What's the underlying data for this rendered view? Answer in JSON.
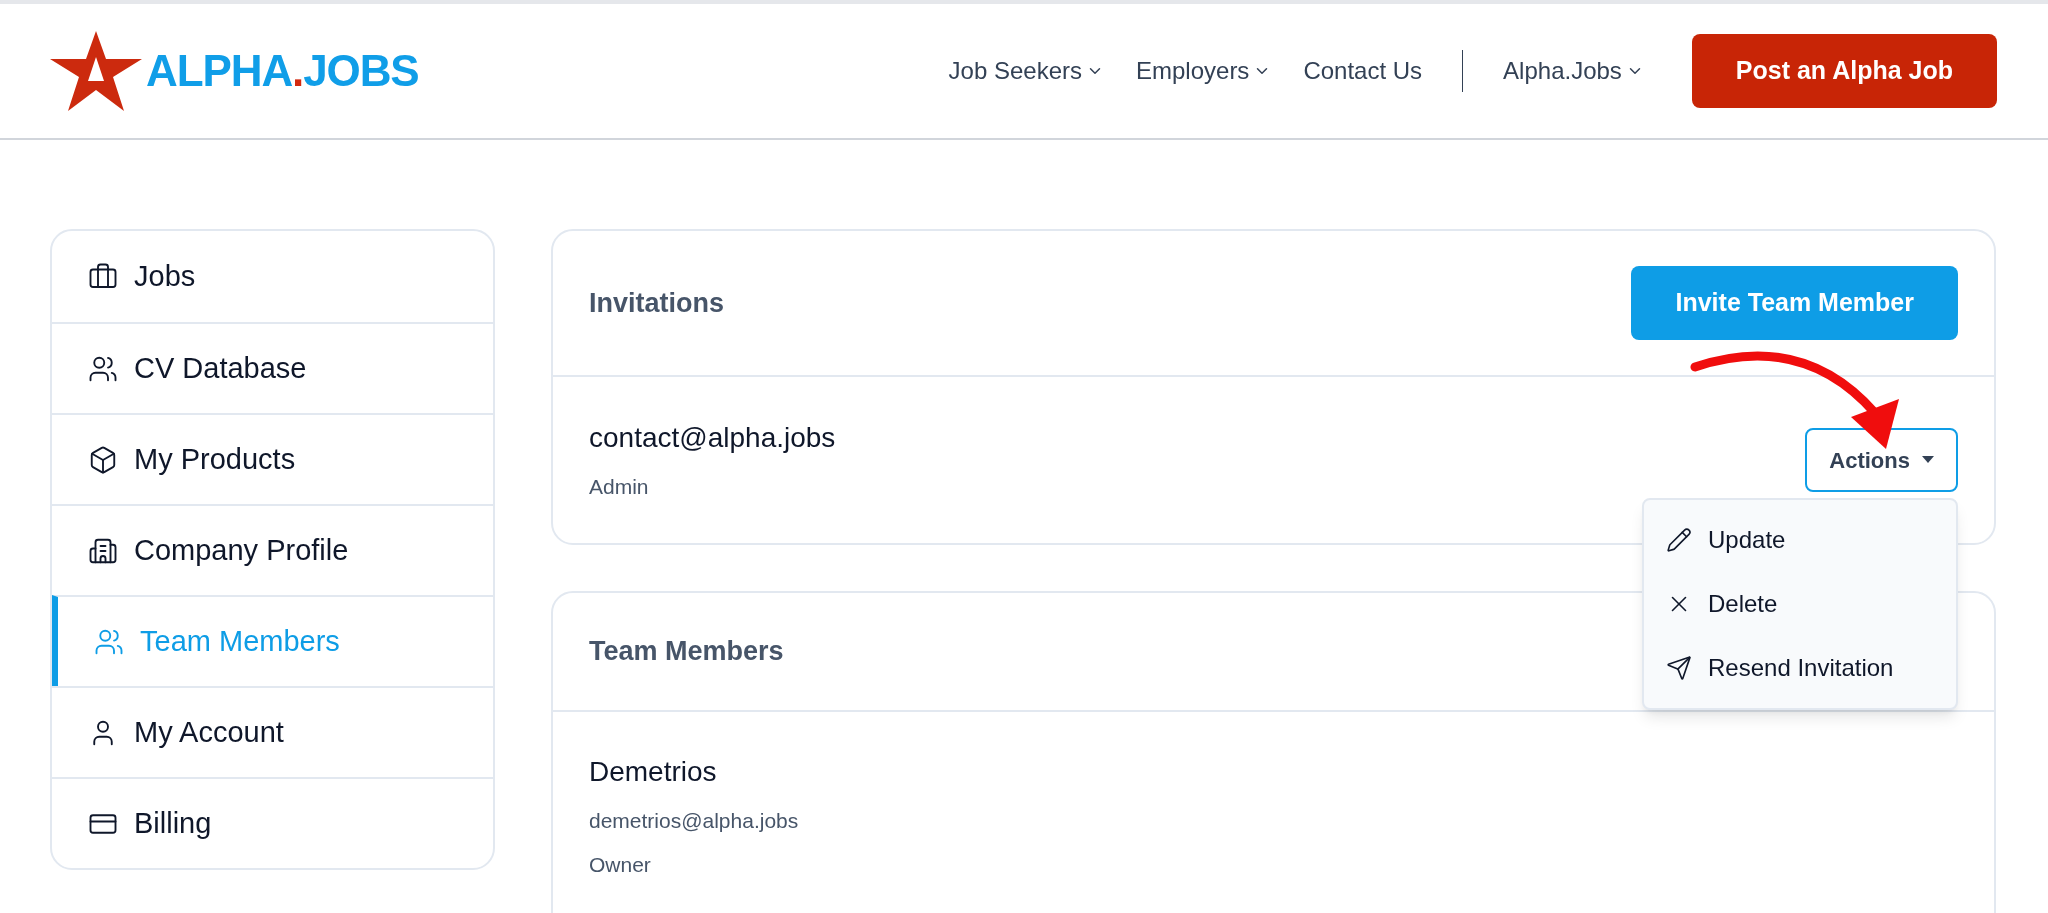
{
  "header": {
    "logo": {
      "parts": [
        {
          "text": "ALPHA",
          "color": "#109ee8"
        },
        {
          "text": ".",
          "color": "#d42a10"
        },
        {
          "text": "JOBS",
          "color": "#109ee8"
        }
      ]
    },
    "nav": [
      {
        "label": "Job Seekers",
        "kind": "dropdown"
      },
      {
        "label": "Employers",
        "kind": "dropdown"
      },
      {
        "label": "Contact Us",
        "kind": "link"
      },
      {
        "kind": "divider"
      },
      {
        "label": "Alpha.Jobs",
        "kind": "dropdown"
      }
    ],
    "cta": "Post an Alpha Job"
  },
  "sidebar": {
    "items": [
      {
        "label": "Jobs",
        "kind": "briefcase",
        "selected": false
      },
      {
        "label": "CV Database",
        "kind": "people",
        "selected": false
      },
      {
        "label": "My Products",
        "kind": "box",
        "selected": false
      },
      {
        "label": "Company Profile",
        "kind": "building",
        "selected": false
      },
      {
        "label": "Team Members",
        "kind": "people",
        "selected": true
      },
      {
        "label": "My Account",
        "kind": "person",
        "selected": false
      },
      {
        "label": "Billing",
        "kind": "card",
        "selected": false
      }
    ]
  },
  "invitations": {
    "title": "Invitations",
    "invite_button": "Invite Team Member",
    "rows": [
      {
        "email": "contact@alpha.jobs",
        "role": "Admin",
        "actions": {
          "label": "Actions",
          "expanded": true,
          "menu": [
            {
              "label": "Update",
              "kind": "edit"
            },
            {
              "label": "Delete",
              "kind": "delete"
            },
            {
              "label": "Resend Invitation",
              "kind": "send"
            }
          ]
        }
      }
    ]
  },
  "team_members": {
    "title": "Team Members",
    "rows": [
      {
        "name": "Demetrios",
        "email": "demetrios@alpha.jobs",
        "role": "Owner"
      }
    ]
  }
}
